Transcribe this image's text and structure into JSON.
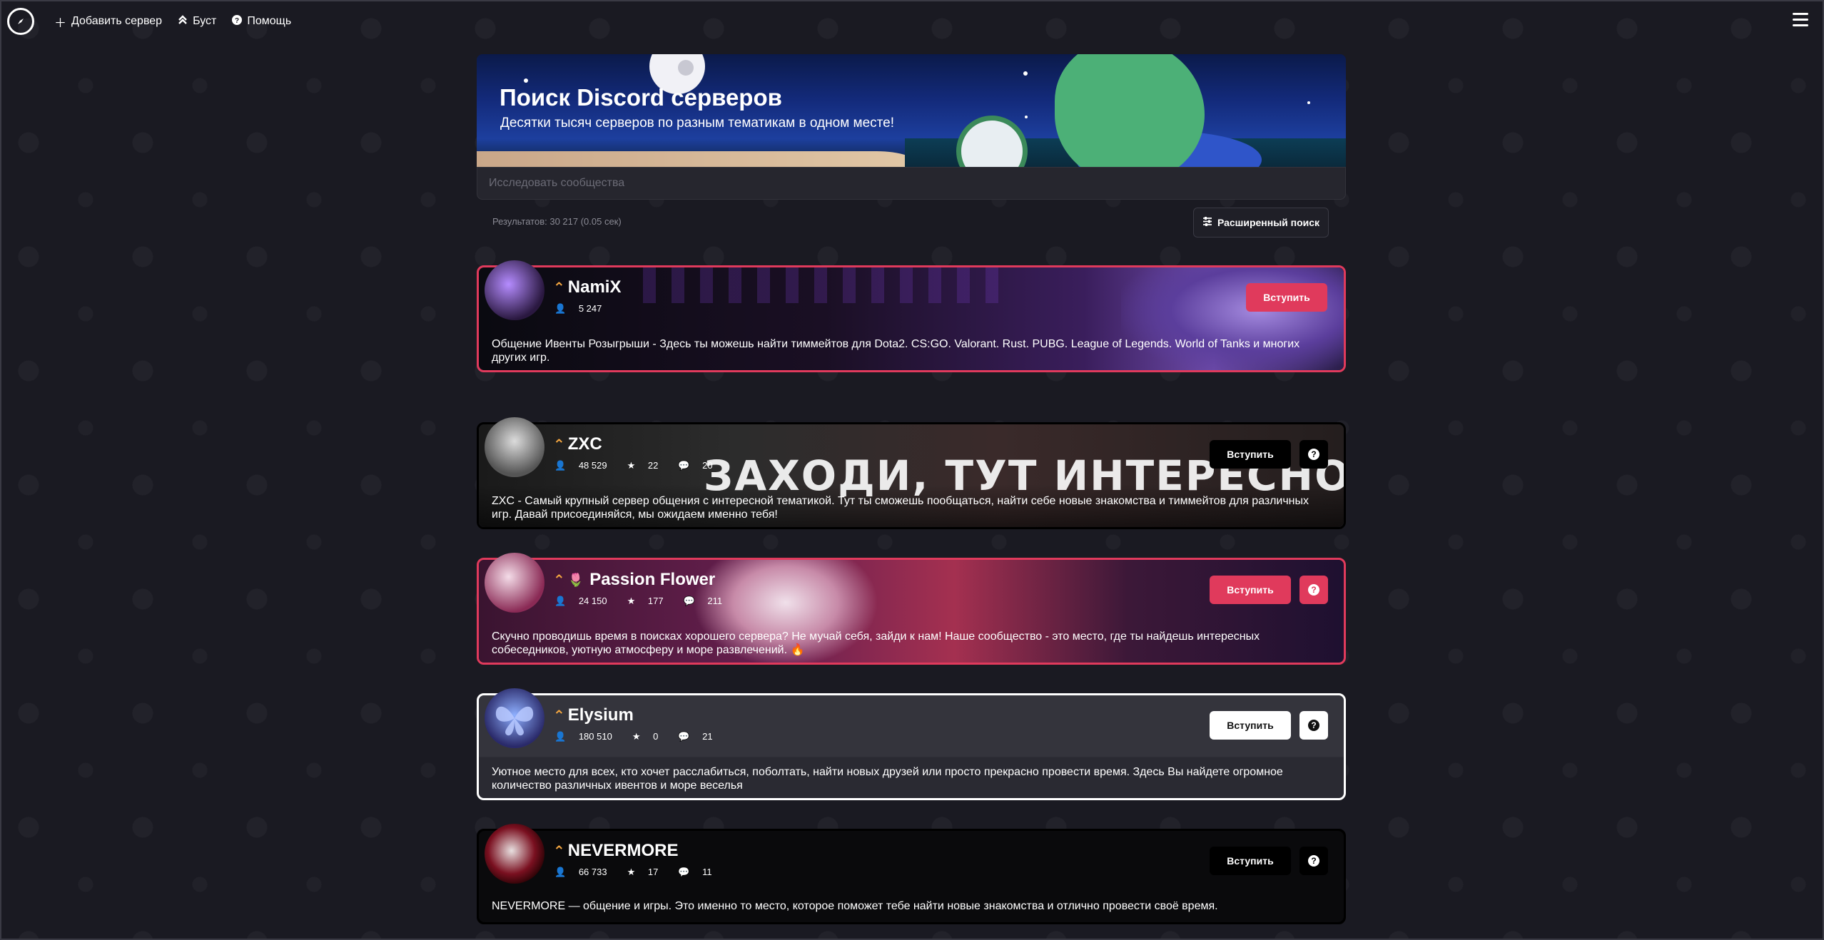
{
  "nav": {
    "add_server": "Добавить сервер",
    "boost": "Буст",
    "help": "Помощь"
  },
  "hero": {
    "title": "Поиск Discord серверов",
    "subtitle": "Десятки тысяч серверов по разным тематикам в одном месте!"
  },
  "search": {
    "placeholder": "Исследовать сообщества"
  },
  "results": {
    "text": "Результатов: 30 217 (0.05 сек)",
    "advanced_search": "Расширенный поиск"
  },
  "servers": [
    {
      "name": "NamiX",
      "members": "5 247",
      "join_label": "Вступить",
      "description": "Общение Ивенты Розыгрыши - Здесь ты можешь найти тиммейтов для Dota2. CS:GO. Valorant. Rust. PUBG. League of Legends. World of Tanks и многих других игр."
    },
    {
      "name": "ZXC",
      "members": "48 529",
      "stars": "22",
      "comments": "20",
      "banner_text": "ЗАХОДИ, ТУТ ИНТЕРЕСНО",
      "join_label": "Вступить",
      "description": "ZXC - Самый крупный сервер общения с интересной тематикой. Тут ты сможешь пообщаться, найти себе новые знакомства и тиммейтов для различных игр. Давай присоединяйся, мы ожидаем именно тебя!"
    },
    {
      "name": "Passion Flower",
      "members": "24 150",
      "stars": "177",
      "comments": "211",
      "join_label": "Вступить",
      "description": "Скучно проводишь время в поисках хорошего сервера? Не мучай себя, зайди к нам! Наше сообщество - это место, где ты найдешь интересных собеседников, уютную атмосферу и море развлечений. 🔥"
    },
    {
      "name": "Elysium",
      "members": "180 510",
      "stars": "0",
      "comments": "21",
      "join_label": "Вступить",
      "description": "Уютное место для всех, кто хочет расслабиться, поболтать, найти новых друзей или просто прекрасно провести время. Здесь Вы найдете огромное количество различных ивентов и море веселья"
    },
    {
      "name": "NEVERMORE",
      "members": "66 733",
      "stars": "17",
      "comments": "11",
      "join_label": "Вступить",
      "description": "NEVERMORE — общение и игры. Это именно то место, которое поможет тебе найти новые знакомства и отлично провести своё время."
    }
  ],
  "colors": {
    "accent": "#e03a5c",
    "background": "#1a1a22",
    "boost": "#f4a640"
  }
}
